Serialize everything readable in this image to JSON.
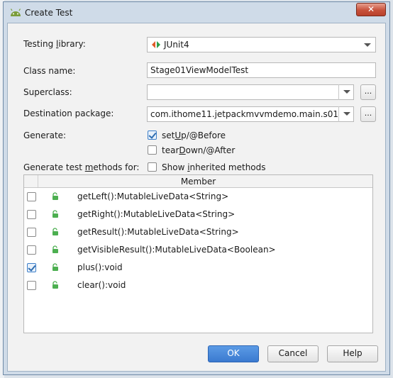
{
  "window": {
    "title": "Create Test",
    "close_symbol": "✕"
  },
  "colors": {
    "accent": "#3b7ad0",
    "lock": "#4caf50",
    "junit_left": "#e05a28",
    "junit_right": "#2e9e4a"
  },
  "form": {
    "testing_library": {
      "label_pre": "Testing ",
      "label_key": "l",
      "label_post": "ibrary:",
      "value": "JUnit4",
      "icon": "junit-icon"
    },
    "class_name": {
      "label": "Class name:",
      "value": "Stage01ViewModelTest"
    },
    "superclass": {
      "label": "Superclass:",
      "value": "",
      "browse_label": "..."
    },
    "destination_package": {
      "label": "Destination package:",
      "value": "com.ithome11.jetpackmvvmdemo.main.s01",
      "browse_label": "..."
    },
    "generate": {
      "label": "Generate:",
      "options": [
        {
          "pre": "set",
          "key": "U",
          "post": "p/@Before",
          "checked": true
        },
        {
          "pre": "tear",
          "key": "D",
          "post": "own/@After",
          "checked": false
        }
      ]
    },
    "methods_for": {
      "label_pre": "Generate test ",
      "label_key": "m",
      "label_post": "ethods for:",
      "show_inherited": {
        "pre": "Show ",
        "key": "i",
        "post": "nherited methods",
        "checked": false
      }
    }
  },
  "members": {
    "header": "Member",
    "rows": [
      {
        "name": "getLeft():MutableLiveData<String>",
        "checked": false
      },
      {
        "name": "getRight():MutableLiveData<String>",
        "checked": false
      },
      {
        "name": "getResult():MutableLiveData<String>",
        "checked": false
      },
      {
        "name": "getVisibleResult():MutableLiveData<Boolean>",
        "checked": false
      },
      {
        "name": "plus():void",
        "checked": true
      },
      {
        "name": "clear():void",
        "checked": false
      }
    ]
  },
  "buttons": {
    "ok": "OK",
    "cancel": "Cancel",
    "help": "Help"
  }
}
